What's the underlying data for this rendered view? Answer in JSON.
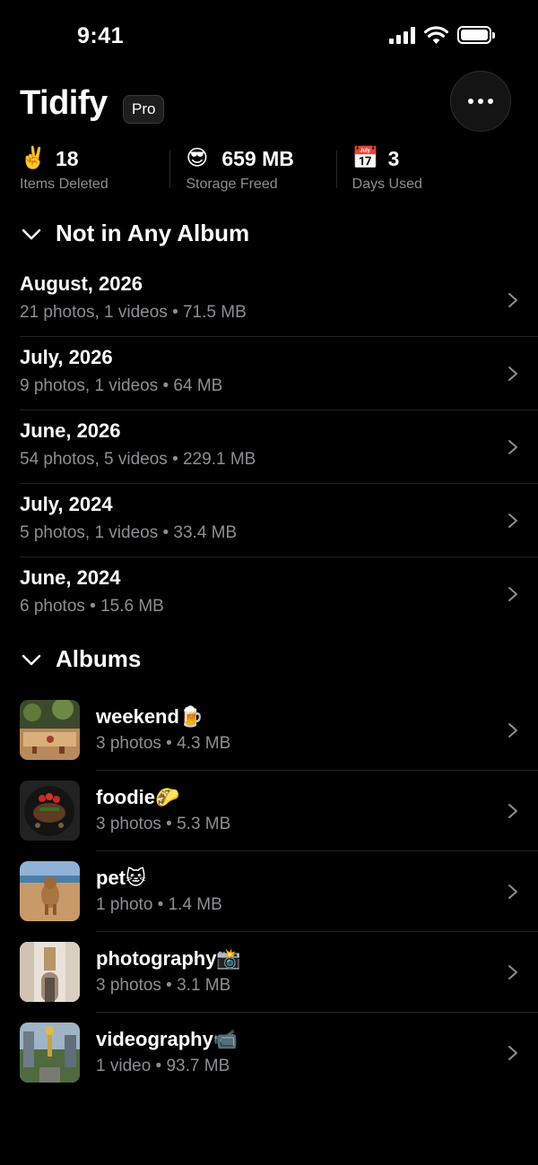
{
  "status": {
    "time": "9:41"
  },
  "app": {
    "title": "Tidify",
    "badge": "Pro"
  },
  "stats": [
    {
      "emoji": "✌️",
      "value": "18",
      "label": "Items Deleted"
    },
    {
      "emoji": "😎",
      "value": "659 MB",
      "label": "Storage Freed"
    },
    {
      "emoji": "📅",
      "value": "3",
      "label": "Days Used"
    }
  ],
  "not_in_album": {
    "title": "Not in Any Album",
    "rows": [
      {
        "name": "August, 2026",
        "meta": "21 photos, 1 videos • 71.5 MB"
      },
      {
        "name": "July, 2026",
        "meta": "9 photos, 1 videos • 64 MB"
      },
      {
        "name": "June, 2026",
        "meta": "54 photos, 5 videos • 229.1 MB"
      },
      {
        "name": "July, 2024",
        "meta": "5 photos, 1 videos • 33.4 MB"
      },
      {
        "name": "June, 2024",
        "meta": "6 photos • 15.6 MB"
      }
    ]
  },
  "albums": {
    "title": "Albums",
    "rows": [
      {
        "name": "weekend🍺",
        "meta": "3 photos • 4.3 MB"
      },
      {
        "name": "foodie🌮",
        "meta": "3 photos • 5.3 MB"
      },
      {
        "name": "pet🐱",
        "meta": "1 photo • 1.4 MB"
      },
      {
        "name": "photography📸",
        "meta": "3 photos • 3.1 MB"
      },
      {
        "name": "videography📹",
        "meta": "1 video • 93.7 MB"
      }
    ]
  }
}
